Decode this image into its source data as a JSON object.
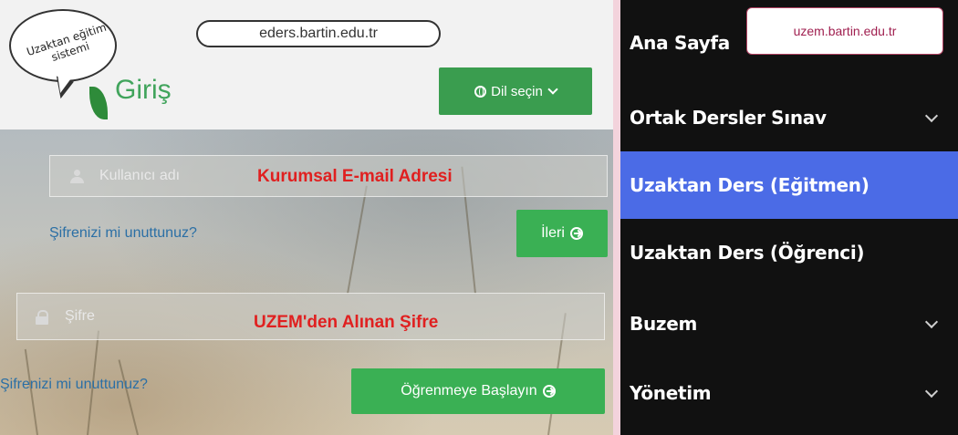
{
  "left_panel": {
    "callout_text": "Uzaktan eğitim sistemi",
    "url_label": "eders.bartin.edu.tr",
    "login_title": "Giriş",
    "language_button": "Dil seçin",
    "username_placeholder": "Kullanıcı adı",
    "username_note": "Kurumsal E-mail Adresi",
    "forgot_password_link_1": "Şifrenizi mi unuttunuz?",
    "next_button": "İleri",
    "password_placeholder": "Şifre",
    "password_note": "UZEM'den Alınan Şifre",
    "forgot_password_link_2": "Şifrenizi mi unuttunuz?",
    "start_button": "Öğrenmeye Başlayın",
    "colors": {
      "green": "#3ab054",
      "note_red": "#e02020",
      "link_blue": "#2b6fa5"
    }
  },
  "right_panel": {
    "url_label": "uzem.bartin.edu.tr",
    "menu_items": [
      {
        "label": "Ana Sayfa",
        "has_chevron": false,
        "active": false
      },
      {
        "label": "Ortak Dersler Sınav",
        "has_chevron": true,
        "active": false
      },
      {
        "label": "Uzaktan Ders (Eğitmen)",
        "has_chevron": false,
        "active": true
      },
      {
        "label": "Uzaktan Ders (Öğrenci)",
        "has_chevron": false,
        "active": false
      },
      {
        "label": "Buzem",
        "has_chevron": true,
        "active": false
      },
      {
        "label": "Yönetim",
        "has_chevron": true,
        "active": false
      }
    ],
    "colors": {
      "background": "#111111",
      "active": "#4b6be6"
    }
  }
}
